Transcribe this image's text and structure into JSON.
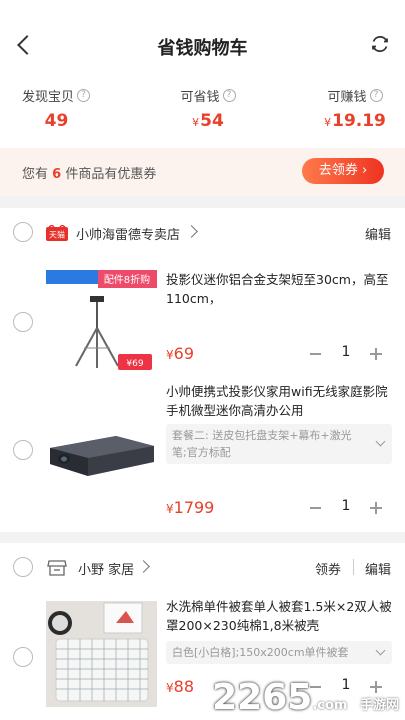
{
  "header": {
    "title": "省钱购物车"
  },
  "stats": [
    {
      "label": "发现宝贝",
      "currency": "",
      "value": "49"
    },
    {
      "label": "可省钱",
      "currency": "¥",
      "value": "54"
    },
    {
      "label": "可赚钱",
      "currency": "¥",
      "value": "19.19"
    }
  ],
  "coupon_bar": {
    "prefix": "您有",
    "count": "6",
    "suffix": "件商品有优惠券",
    "button": "去领券 ›"
  },
  "stores": [
    {
      "badge": "天猫",
      "name": "小帅海雷德专卖店",
      "edit": "编辑",
      "items": [
        {
          "title": "投影仪迷你铝合金支架短至30cm，高至110cm，",
          "thumb_label_top": "配件8折购",
          "thumb_label_price": "¥69",
          "price_currency": "¥",
          "price": "69",
          "qty": "1"
        },
        {
          "title": "小帅便携式投影仪家用wifi无线家庭影院手机微型迷你高清办公用",
          "sku": "套餐二: 送皮包托盘支架+幕布+激光笔;官方标配",
          "price_currency": "¥",
          "price": "1799",
          "qty": "1"
        }
      ]
    },
    {
      "name": "小野 家居",
      "coupon": "领券",
      "edit": "编辑",
      "items": [
        {
          "title": "水洗棉单件被套单人被套1.5米×2双人被罩200×230纯棉1,8米被壳",
          "sku": "白色[小白格];150x200cm单件被套",
          "price_currency": "¥",
          "price": "88",
          "qty": "1"
        }
      ]
    }
  ],
  "watermark": {
    "text": "2265",
    "suffix": ".com",
    "sub": "手游网"
  }
}
